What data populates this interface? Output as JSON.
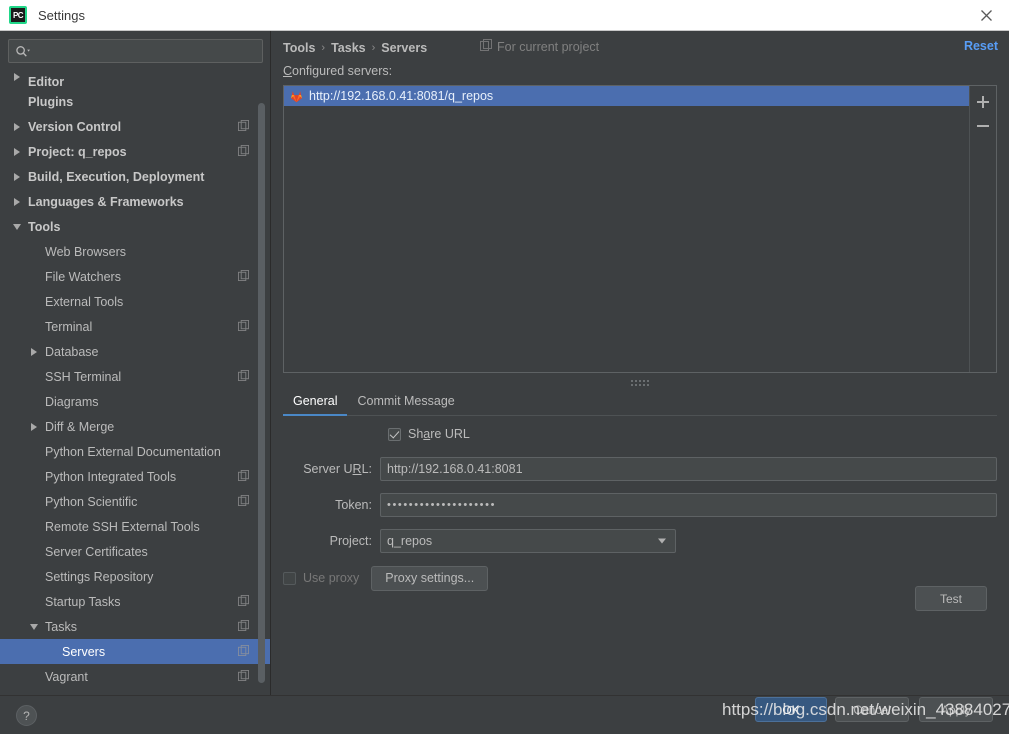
{
  "window": {
    "title": "Settings",
    "logo_text": "PC",
    "close_icon": "close-icon"
  },
  "search": {
    "placeholder": "",
    "value": "",
    "icon": "search-icon"
  },
  "sidebar": {
    "items": [
      {
        "label": "Editor",
        "level": 0,
        "bold": true,
        "arrow": "right",
        "badge": false,
        "selected": false,
        "clipped": true
      },
      {
        "label": "Plugins",
        "level": 0,
        "bold": true,
        "arrow": "none",
        "badge": false,
        "selected": false
      },
      {
        "label": "Version Control",
        "level": 0,
        "bold": true,
        "arrow": "right",
        "badge": true,
        "selected": false
      },
      {
        "label": "Project: q_repos",
        "level": 0,
        "bold": true,
        "arrow": "right",
        "badge": true,
        "selected": false
      },
      {
        "label": "Build, Execution, Deployment",
        "level": 0,
        "bold": true,
        "arrow": "right",
        "badge": false,
        "selected": false
      },
      {
        "label": "Languages & Frameworks",
        "level": 0,
        "bold": true,
        "arrow": "right",
        "badge": false,
        "selected": false
      },
      {
        "label": "Tools",
        "level": 0,
        "bold": true,
        "arrow": "down",
        "badge": false,
        "selected": false
      },
      {
        "label": "Web Browsers",
        "level": 1,
        "bold": false,
        "arrow": "none",
        "badge": false,
        "selected": false
      },
      {
        "label": "File Watchers",
        "level": 1,
        "bold": false,
        "arrow": "none",
        "badge": true,
        "selected": false
      },
      {
        "label": "External Tools",
        "level": 1,
        "bold": false,
        "arrow": "none",
        "badge": false,
        "selected": false
      },
      {
        "label": "Terminal",
        "level": 1,
        "bold": false,
        "arrow": "none",
        "badge": true,
        "selected": false
      },
      {
        "label": "Database",
        "level": 1,
        "bold": false,
        "arrow": "right",
        "badge": false,
        "selected": false
      },
      {
        "label": "SSH Terminal",
        "level": 1,
        "bold": false,
        "arrow": "none",
        "badge": true,
        "selected": false
      },
      {
        "label": "Diagrams",
        "level": 1,
        "bold": false,
        "arrow": "none",
        "badge": false,
        "selected": false
      },
      {
        "label": "Diff & Merge",
        "level": 1,
        "bold": false,
        "arrow": "right",
        "badge": false,
        "selected": false
      },
      {
        "label": "Python External Documentation",
        "level": 1,
        "bold": false,
        "arrow": "none",
        "badge": false,
        "selected": false
      },
      {
        "label": "Python Integrated Tools",
        "level": 1,
        "bold": false,
        "arrow": "none",
        "badge": true,
        "selected": false
      },
      {
        "label": "Python Scientific",
        "level": 1,
        "bold": false,
        "arrow": "none",
        "badge": true,
        "selected": false
      },
      {
        "label": "Remote SSH External Tools",
        "level": 1,
        "bold": false,
        "arrow": "none",
        "badge": false,
        "selected": false
      },
      {
        "label": "Server Certificates",
        "level": 1,
        "bold": false,
        "arrow": "none",
        "badge": false,
        "selected": false
      },
      {
        "label": "Settings Repository",
        "level": 1,
        "bold": false,
        "arrow": "none",
        "badge": false,
        "selected": false
      },
      {
        "label": "Startup Tasks",
        "level": 1,
        "bold": false,
        "arrow": "none",
        "badge": true,
        "selected": false
      },
      {
        "label": "Tasks",
        "level": 1,
        "bold": false,
        "arrow": "down",
        "badge": true,
        "selected": false
      },
      {
        "label": "Servers",
        "level": 2,
        "bold": false,
        "arrow": "none",
        "badge": true,
        "selected": true
      },
      {
        "label": "Vagrant",
        "level": 1,
        "bold": false,
        "arrow": "none",
        "badge": true,
        "selected": false
      }
    ]
  },
  "main": {
    "breadcrumb": [
      "Tools",
      "Tasks",
      "Servers"
    ],
    "breadcrumb_separator": "›",
    "for_current_project": "For current project",
    "for_current_project_icon": "project-scope-icon",
    "reset_label": "Reset",
    "configured_servers_label": "Configured servers:",
    "configured_servers_mnemonic": "C",
    "servers": [
      {
        "label": "http://192.168.0.41:8081/q_repos",
        "icon": "gitlab-fox-icon",
        "selected": true
      }
    ],
    "list_toolbar": {
      "add_label": "+",
      "remove_label": "−"
    },
    "tabs": [
      {
        "label": "General",
        "active": true
      },
      {
        "label": "Commit Message",
        "active": false
      }
    ],
    "form": {
      "share_url": {
        "label_pre": "Sh",
        "label_mnemonic": "a",
        "label_post": "re URL",
        "label": "Share URL",
        "checked": true
      },
      "server_url": {
        "label_pre": "Server U",
        "label_mnemonic": "R",
        "label_post": "L:",
        "label": "Server URL:",
        "value": "http://192.168.0.41:8081"
      },
      "token": {
        "label": "Token:",
        "value": "••••••••••••••••••••",
        "masked": true
      },
      "project": {
        "label": "Project:",
        "value": "q_repos",
        "options": [
          "q_repos"
        ]
      },
      "use_proxy": {
        "label": "Use proxy",
        "checked": false,
        "disabled": true
      },
      "proxy_settings_button": "Proxy settings...",
      "test_button": "Test"
    }
  },
  "footer": {
    "help_label": "?",
    "ok_label": "OK",
    "cancel_label": "Cancel",
    "apply_label": "Apply"
  },
  "watermark": {
    "text": "https://blog.csdn.net/weixin_43884027"
  },
  "colors": {
    "accent_selection": "#4b6eaf",
    "primary_button": "#365880",
    "link": "#589df6",
    "tab_underline": "#4a88c7",
    "panel_bg": "#3c3f41",
    "input_bg": "#45494a",
    "gitlab_orange": "#e24329"
  }
}
